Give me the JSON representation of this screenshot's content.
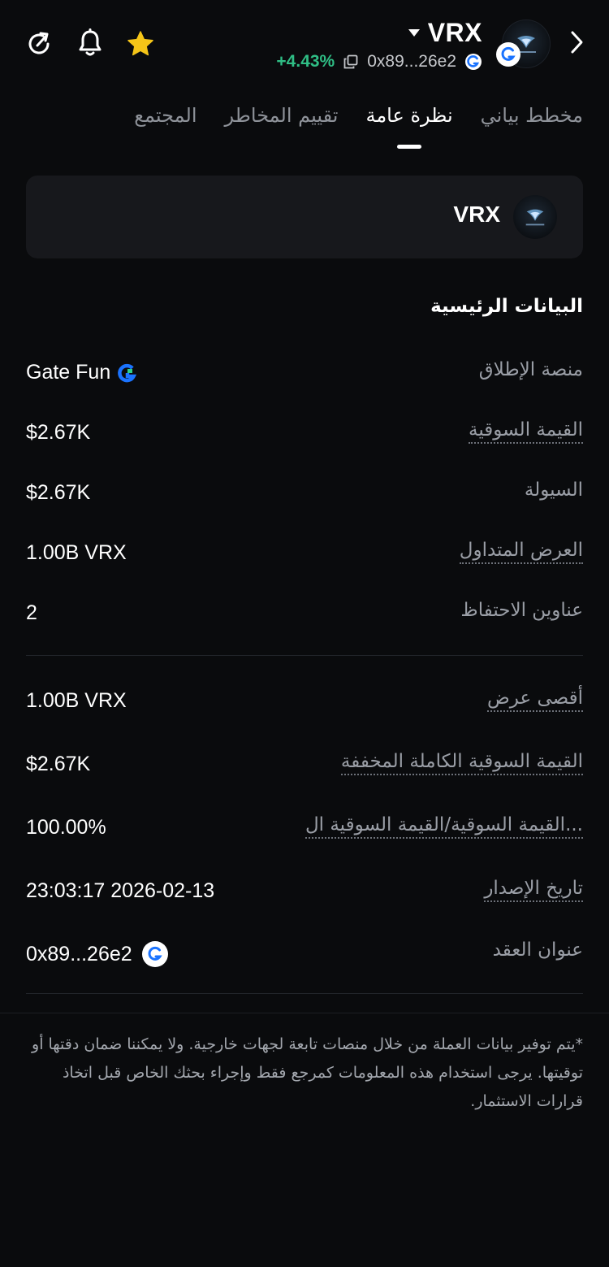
{
  "header": {
    "token_symbol": "VRX",
    "price_change": "+4.43%",
    "contract_short": "0x89...26e2",
    "colors": {
      "positive": "#2fbe85",
      "star": "#f5c518",
      "chain_blue": "#1a73ff"
    },
    "icons": [
      "refresh-icon",
      "bell-icon",
      "star-icon",
      "caret-down-icon",
      "copy-icon",
      "chevron-right-icon"
    ]
  },
  "tabs": [
    {
      "label": "مخطط بياني",
      "active": false
    },
    {
      "label": "نظرة عامة",
      "active": true
    },
    {
      "label": "تقييم المخاطر",
      "active": false
    },
    {
      "label": "المجتمع",
      "active": false
    }
  ],
  "card": {
    "symbol": "VRX"
  },
  "main_data": {
    "title": "البيانات الرئيسية",
    "rows": [
      {
        "label": "منصة الإطلاق",
        "value": "Gate Fun"
      },
      {
        "label": "القيمة السوقية",
        "value": "$2.67K"
      },
      {
        "label": "السيولة",
        "value": "$2.67K"
      },
      {
        "label": "العرض المتداول",
        "value": "1.00B VRX"
      },
      {
        "label": "عناوين الاحتفاظ",
        "value": "2"
      }
    ],
    "rows2": [
      {
        "label": "أقصى عرض",
        "value": "1.00B VRX"
      },
      {
        "label": "القيمة السوقية الكاملة المخففة",
        "value": "$2.67K"
      },
      {
        "label": "القيمة السوقية/القيمة السوقية ال...",
        "value": "100.00%"
      },
      {
        "label": "تاريخ الإصدار",
        "value": "23:03:17 2026-02-13"
      },
      {
        "label": "عنوان العقد",
        "value": "0x89...26e2"
      }
    ]
  },
  "disclaimer": "*يتم توفير بيانات العملة من خلال منصات تابعة لجهات خارجية. ولا يمكننا ضمان دقتها أو توقيتها. يرجى استخدام هذه المعلومات كمرجع فقط وإجراء بحثك الخاص قبل اتخاذ قرارات الاستثمار."
}
